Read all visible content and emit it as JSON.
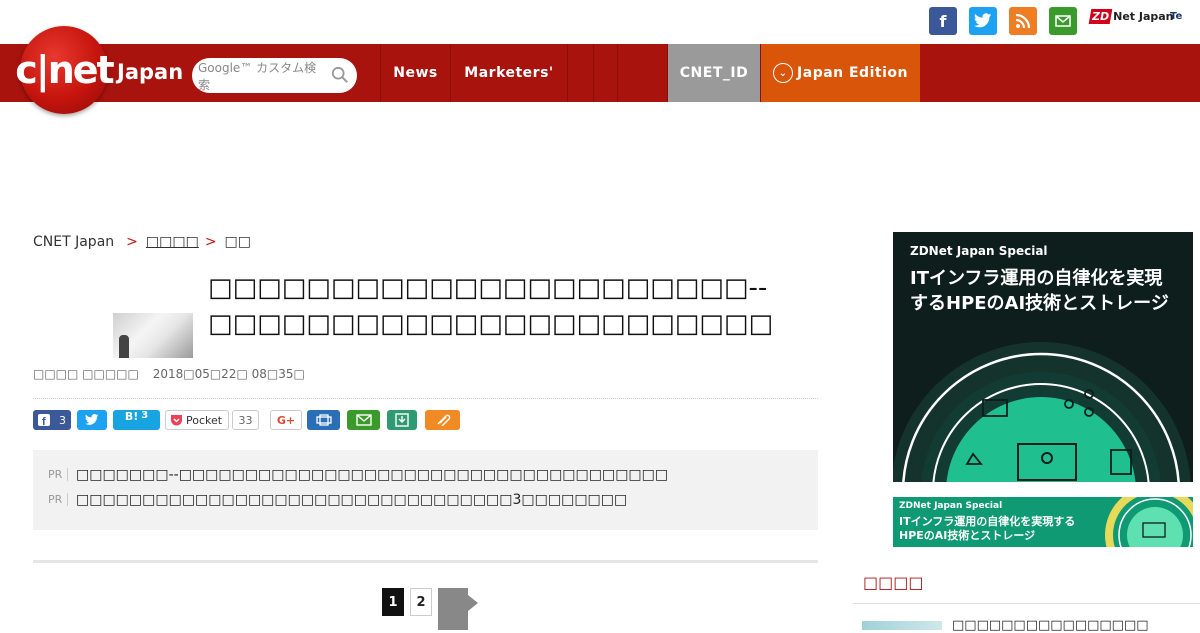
{
  "header": {
    "social_icons": [
      "facebook-icon",
      "twitter-icon",
      "rss-icon",
      "mail-icon"
    ],
    "partner_logos": {
      "zdnet": "Net Japan",
      "zdnet_mark": "ZD",
      "te": "Te"
    }
  },
  "nav": {
    "logo_text": "c|net",
    "logo_sub": "Japan",
    "search_placeholder": "Google™ カスタム検索",
    "items": [
      {
        "label": "News"
      },
      {
        "label": "Marketers'"
      },
      {
        "label": ""
      },
      {
        "label": ""
      },
      {
        "label": ""
      },
      {
        "label": "CNET_ID"
      },
      {
        "label": "Japan Edition"
      }
    ],
    "colors": {
      "bar": "#a8130e",
      "id_bg": "#9a9a9a",
      "edition_bg": "#d9550a"
    }
  },
  "breadcrumb": {
    "home": "CNET Japan",
    "sep": ">",
    "level2": "□□□□",
    "level3": "□□"
  },
  "article": {
    "title": "□□□□□□□□□□□□□□□□□□□□□□--□□□□□□□□□□□□□□□□□□□□□□□",
    "author": "□□□□ □□□□□",
    "date": "2018□05□22□ 08□35□",
    "share": {
      "facebook_count": "3",
      "hatena_label": "B!",
      "hatena_count": "3",
      "pocket_label": "Pocket",
      "pocket_count": "33",
      "gplus_label": "G+"
    }
  },
  "pr": {
    "tag": "PR",
    "items": [
      "□□□□□□□--□□□□□□□□□□□□□□□□□□□□□□□□□□□□□□□□□□□□□",
      "□□□□□□□□□□□□□□□□□□□□□□□□□□□□□□□□□3□□□□□□□□"
    ]
  },
  "pagination": {
    "pages": [
      "1",
      "2"
    ],
    "current": "1"
  },
  "sidebar": {
    "ad1": {
      "tag": "ZDNet Japan Special",
      "headline": "ITインフラ運用の自律化を実現するHPEのAI技術とストレージ"
    },
    "ad2": {
      "tag": "ZDNet Japan Special",
      "headline": "ITインフラ運用の自律化を実現するHPEのAI技術とストレージ"
    },
    "section_title": "□□□□",
    "first_item": "□□□□□□□□□□□□□□□□"
  }
}
